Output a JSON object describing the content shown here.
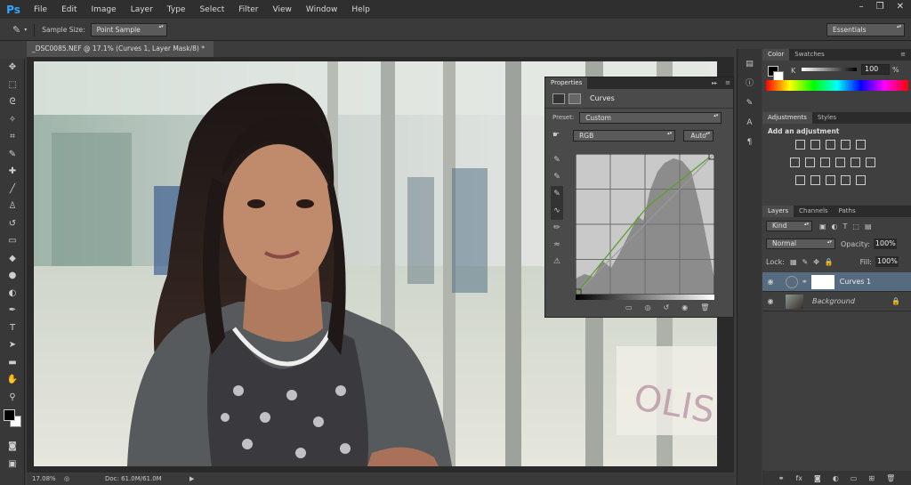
{
  "app": {
    "logo": "Ps"
  },
  "menu": [
    "File",
    "Edit",
    "Image",
    "Layer",
    "Type",
    "Select",
    "Filter",
    "View",
    "Window",
    "Help"
  ],
  "window_controls": {
    "minimize": "–",
    "restore": "❐",
    "close": "✕"
  },
  "options": {
    "sample_size_label": "Sample Size:",
    "sample_size_value": "Point Sample",
    "workspace": "Essentials"
  },
  "document": {
    "tab_title": "_DSC0085.NEF @ 17.1% (Curves 1, Layer Mask/8) *",
    "zoom": "17.08%",
    "doc_info": "Doc: 61.0M/61.0M"
  },
  "properties": {
    "tab": "Properties",
    "title": "Curves",
    "preset_label": "Preset:",
    "preset_value": "Custom",
    "channel": "RGB",
    "auto_label": "Auto"
  },
  "color_panel": {
    "tabs": [
      "Color",
      "Swatches"
    ],
    "k_label": "K",
    "k_value": "100",
    "k_unit": "%"
  },
  "adjustments": {
    "tabs": [
      "Adjustments",
      "Styles"
    ],
    "add_label": "Add an adjustment"
  },
  "layers": {
    "tabs": [
      "Layers",
      "Channels",
      "Paths"
    ],
    "kind": "Kind",
    "blend_mode": "Normal",
    "opacity_label": "Opacity:",
    "opacity_value": "100%",
    "lock_label": "Lock:",
    "fill_label": "Fill:",
    "fill_value": "100%",
    "items": [
      {
        "name": "Curves 1"
      },
      {
        "name": "Background"
      }
    ]
  },
  "photo_text": {
    "sign": "OLIS"
  },
  "colors": {
    "accent": "#31a8ff",
    "panel": "#4a4a4a",
    "chrome": "#2f2f2f"
  }
}
